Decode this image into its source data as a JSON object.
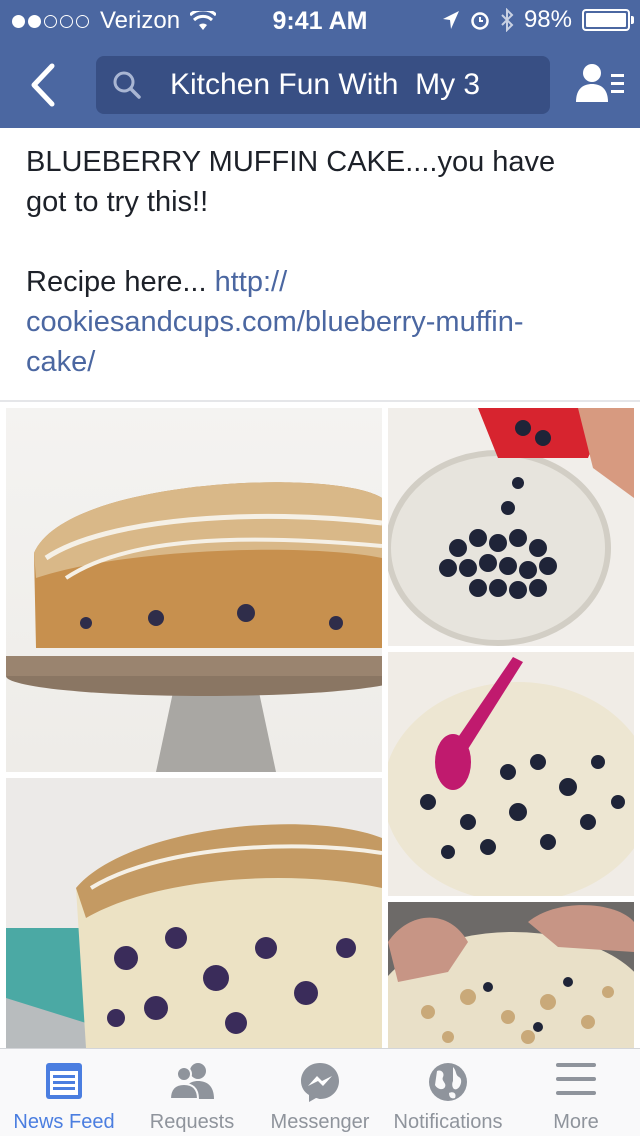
{
  "status_bar": {
    "carrier": "Verizon",
    "time": "9:41 AM",
    "battery": "98%"
  },
  "nav": {
    "search_text": "Kitchen Fun With  My 3"
  },
  "post": {
    "line1": "BLUEBERRY MUFFIN CAKE....you have",
    "line2": "got to try this!!",
    "recipe_prefix": "Recipe here... ",
    "link_part1": "http://",
    "link_part2": "cookiesandcups.com/blueberry-muffin-",
    "link_part3": "cake/"
  },
  "tabs": [
    {
      "label": "News Feed",
      "icon": "news-feed-icon",
      "active": true
    },
    {
      "label": "Requests",
      "icon": "friend-requests-icon",
      "active": false
    },
    {
      "label": "Messenger",
      "icon": "messenger-icon",
      "active": false
    },
    {
      "label": "Notifications",
      "icon": "globe-icon",
      "active": false
    },
    {
      "label": "More",
      "icon": "menu-icon",
      "active": false
    }
  ],
  "colors": {
    "brand": "#4b67a1",
    "link": "#4b67a1",
    "tab_active": "#4b7ee0",
    "tab_inactive": "#8f949c"
  }
}
